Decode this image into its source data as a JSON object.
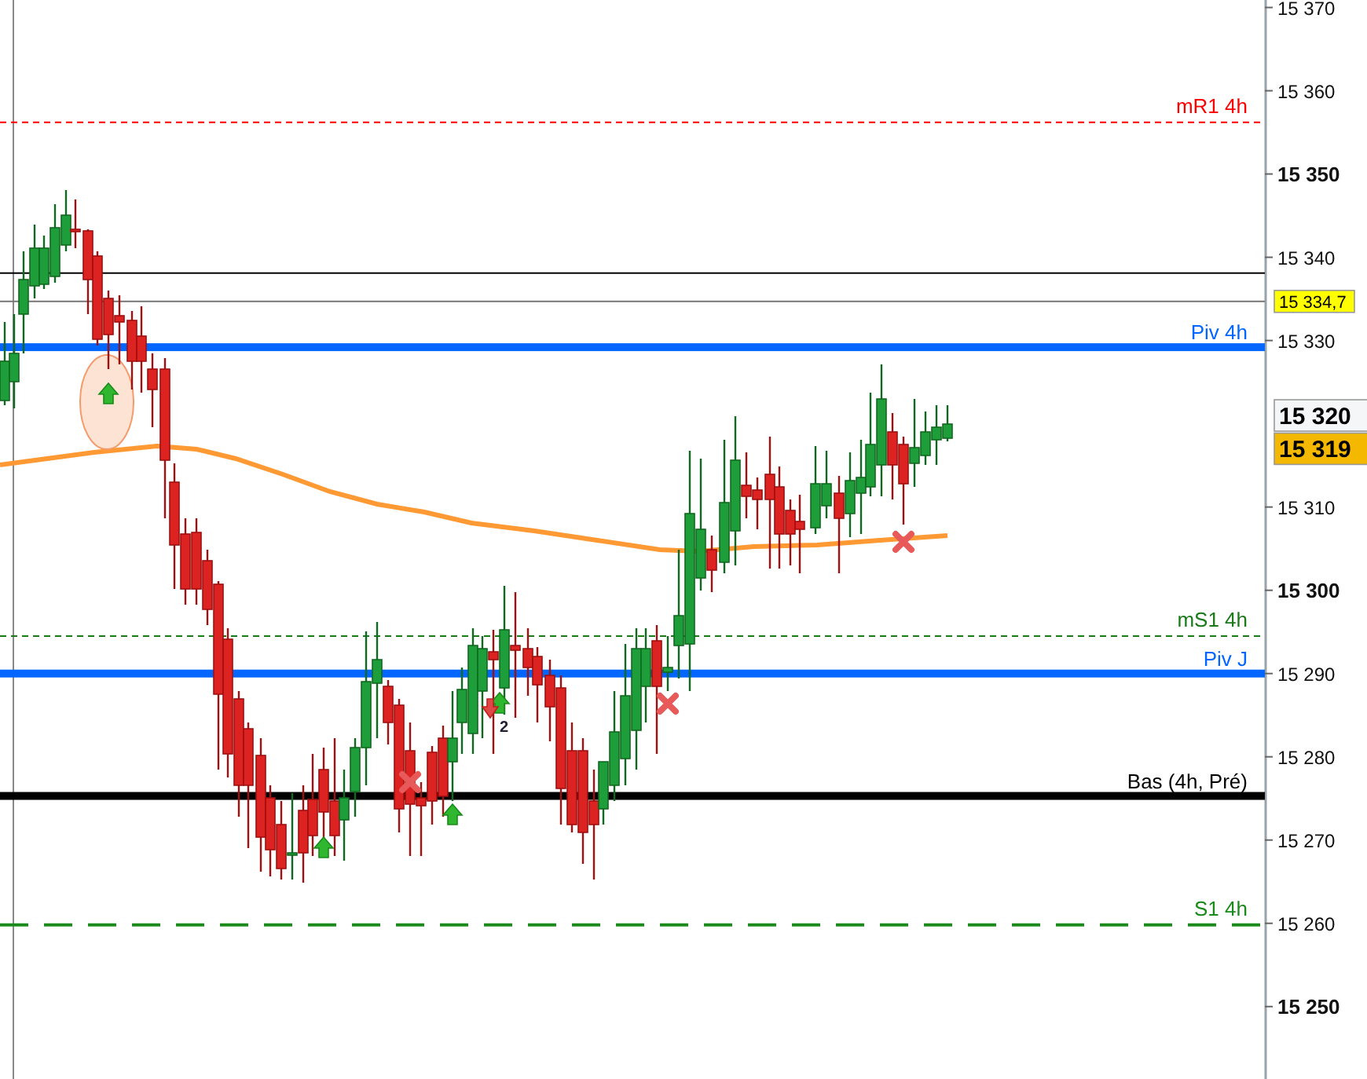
{
  "chart": {
    "axis_ticks": [
      {
        "label": "15 370",
        "major": false
      },
      {
        "label": "15 360",
        "major": false
      },
      {
        "label": "15 350",
        "major": true
      },
      {
        "label": "15 340",
        "major": false
      },
      {
        "label": "15 330",
        "major": false
      },
      {
        "label": "15 310",
        "major": false
      },
      {
        "label": "15 300",
        "major": true
      },
      {
        "label": "15 290",
        "major": false
      },
      {
        "label": "15 280",
        "major": false
      },
      {
        "label": "15 270",
        "major": false
      },
      {
        "label": "15 260",
        "major": false
      },
      {
        "label": "15 250",
        "major": true
      }
    ],
    "levels": [
      {
        "kind": "dotted",
        "label": "mR1 4h",
        "color": "#ff0000"
      },
      {
        "kind": "thin",
        "color": "#000000"
      },
      {
        "kind": "thin",
        "color": "#777777"
      },
      {
        "kind": "thick",
        "label": "Piv 4h",
        "color": "#0066ff"
      },
      {
        "kind": "dotted",
        "label": "mS1 4h",
        "color": "#1a7a1a"
      },
      {
        "kind": "thick",
        "label": "Piv J",
        "color": "#0066ff"
      },
      {
        "kind": "thick",
        "label": "Bas (4h, Pré)",
        "color": "#000000"
      },
      {
        "kind": "dashed",
        "label": "S1 4h",
        "color": "#1a8a1a"
      }
    ],
    "price_badges": [
      {
        "kind": "level",
        "label": "15 334,7"
      },
      {
        "kind": "bid",
        "label": "15 320"
      },
      {
        "kind": "ask",
        "label": "15 319"
      }
    ],
    "marker_label": "2"
  }
}
